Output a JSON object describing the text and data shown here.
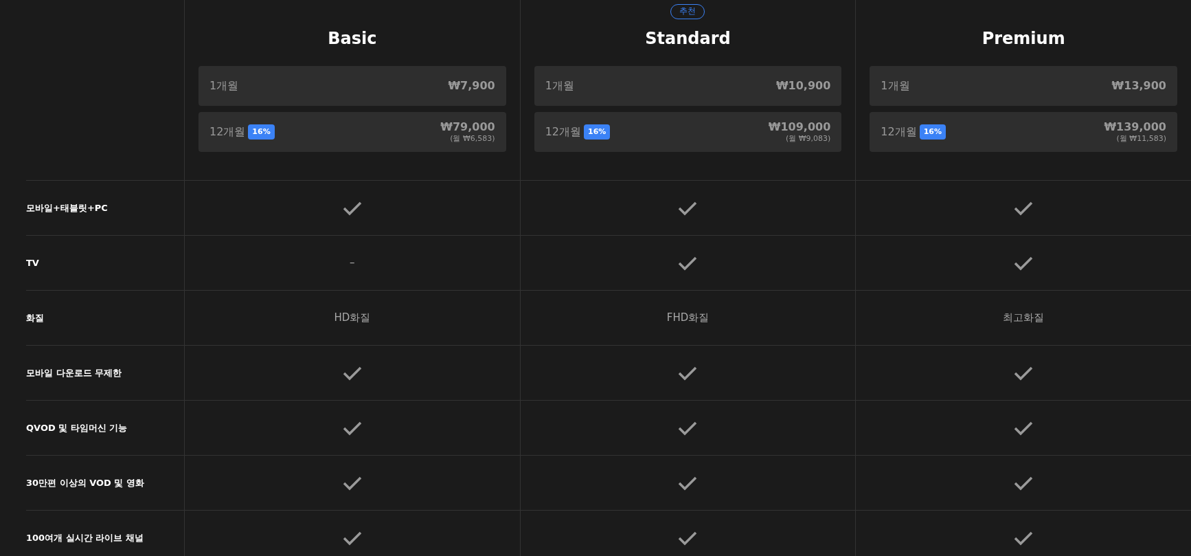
{
  "plans": [
    {
      "name": "Basic",
      "prices": [
        {
          "period": "1개월",
          "price": "₩7,900"
        },
        {
          "period": "12개월",
          "discount": "16%",
          "price": "₩79,000",
          "monthly": "(월 ₩6,583)"
        }
      ]
    },
    {
      "name": "Standard",
      "badge": "추천",
      "prices": [
        {
          "period": "1개월",
          "price": "₩10,900"
        },
        {
          "period": "12개월",
          "discount": "16%",
          "price": "₩109,000",
          "monthly": "(월 ₩9,083)"
        }
      ]
    },
    {
      "name": "Premium",
      "prices": [
        {
          "period": "1개월",
          "price": "₩13,900"
        },
        {
          "period": "12개월",
          "discount": "16%",
          "price": "₩139,000",
          "monthly": "(월 ₩11,583)"
        }
      ]
    }
  ],
  "features": [
    {
      "label": "모바일+태블릿+PC",
      "cells": [
        {
          "kind": "check"
        },
        {
          "kind": "check"
        },
        {
          "kind": "check"
        }
      ]
    },
    {
      "label": "TV",
      "cells": [
        {
          "kind": "text",
          "text": "–"
        },
        {
          "kind": "check"
        },
        {
          "kind": "check"
        }
      ]
    },
    {
      "label": "화질",
      "cells": [
        {
          "kind": "text",
          "text": "HD화질"
        },
        {
          "kind": "text",
          "text": "FHD화질"
        },
        {
          "kind": "text",
          "text": "최고화질"
        }
      ]
    },
    {
      "label": "모바일 다운로드 무제한",
      "cells": [
        {
          "kind": "check"
        },
        {
          "kind": "check"
        },
        {
          "kind": "check"
        }
      ]
    },
    {
      "label": "QVOD 및 타임머신 기능",
      "cells": [
        {
          "kind": "check"
        },
        {
          "kind": "check"
        },
        {
          "kind": "check"
        }
      ]
    },
    {
      "label": "30만편 이상의 VOD 및 영화",
      "cells": [
        {
          "kind": "check"
        },
        {
          "kind": "check"
        },
        {
          "kind": "check"
        }
      ]
    },
    {
      "label": "100여개 실시간 라이브 채널",
      "cells": [
        {
          "kind": "check"
        },
        {
          "kind": "check"
        },
        {
          "kind": "check"
        }
      ]
    }
  ]
}
